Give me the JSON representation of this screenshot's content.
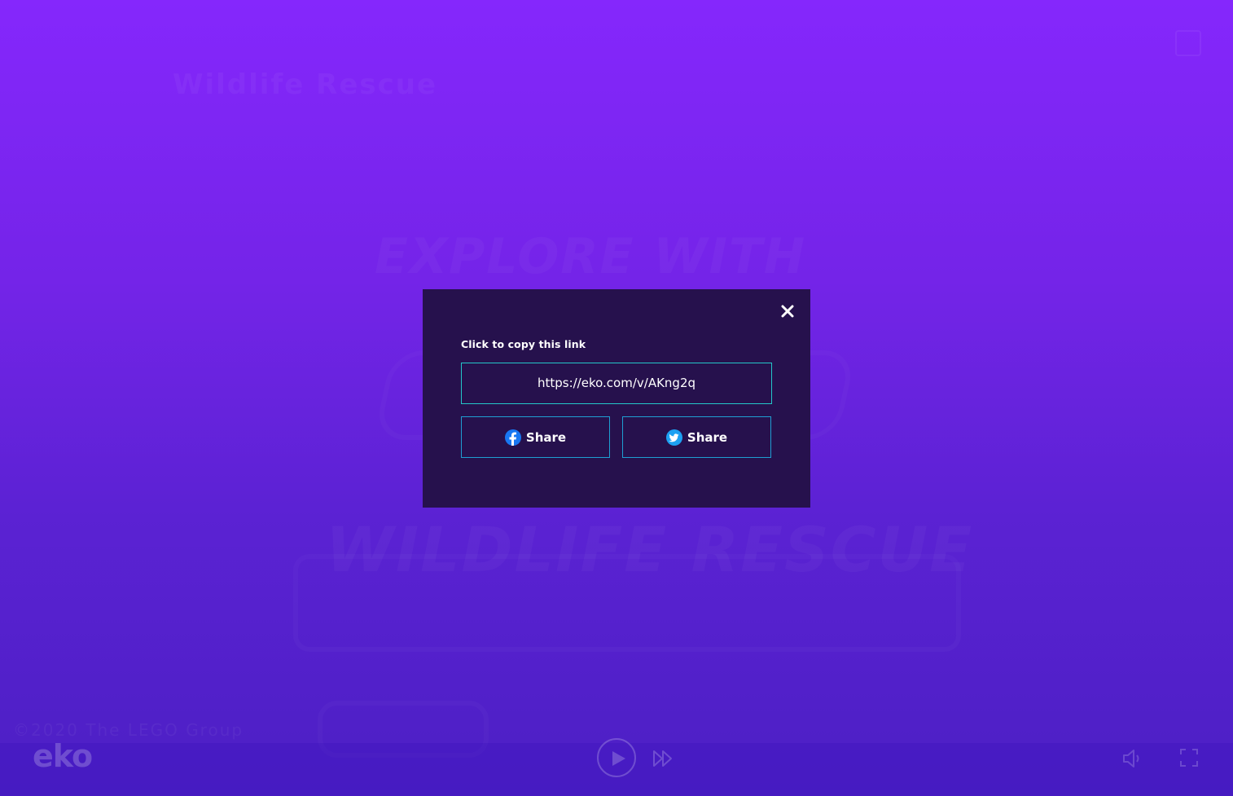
{
  "background": {
    "title": "Wildlife Rescue",
    "headline": "EXPLORE WITH",
    "subhead": "WILDLIFE RESCUE",
    "copyright": "©2020 The LEGO Group"
  },
  "player": {
    "brand": "eko",
    "icons": {
      "play": "play-icon",
      "skip": "fast-forward-icon",
      "volume": "volume-icon",
      "fullscreen": "fullscreen-icon"
    }
  },
  "share_modal": {
    "label": "Click to copy this link",
    "link": "https://eko.com/v/AKng2q",
    "facebook_label": "Share",
    "twitter_label": "Share"
  },
  "colors": {
    "modal_bg": "#26114d",
    "link_border": "#23c7c9",
    "share_border": "#1f9ed2",
    "facebook": "#1877f2",
    "twitter": "#1da1f2"
  }
}
